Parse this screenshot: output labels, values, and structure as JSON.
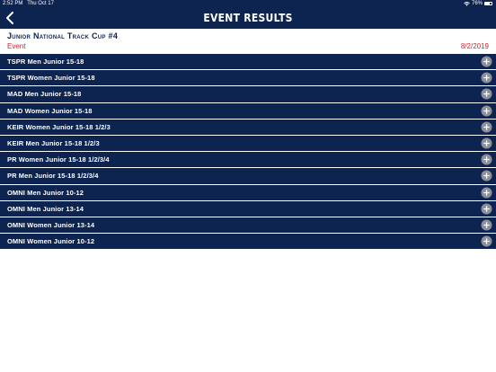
{
  "status": {
    "time": "2:52 PM",
    "date": "Thu Oct 17",
    "battery": "76%",
    "battery_level": 0.76
  },
  "nav": {
    "title": "EVENT RESULTS",
    "back_icon": "chevron-left-icon"
  },
  "meet": {
    "title": "Junior National Track Cup #4"
  },
  "columns": {
    "event": "Event",
    "date": "8/2/2019"
  },
  "events": [
    "TSPR Men Junior 15-18",
    "TSPR Women Junior 15-18",
    "MAD Men Junior 15-18",
    "MAD Women Junior 15-18",
    "KEIR Women Junior 15-18 1/2/3",
    "KEIR Men Junior 15-18 1/2/3",
    "PR Women Junior 15-18 1/2/3/4",
    "PR Men Junior 15-18 1/2/3/4",
    "OMNI Men Junior 10-12",
    "OMNI Men Junior 13-14",
    "OMNI Women Junior 13-14",
    "OMNI Women Junior 10-12"
  ],
  "colors": {
    "navy": "#0d2350",
    "accent_red": "#d2232a",
    "plus_button": "#8a8f99"
  }
}
